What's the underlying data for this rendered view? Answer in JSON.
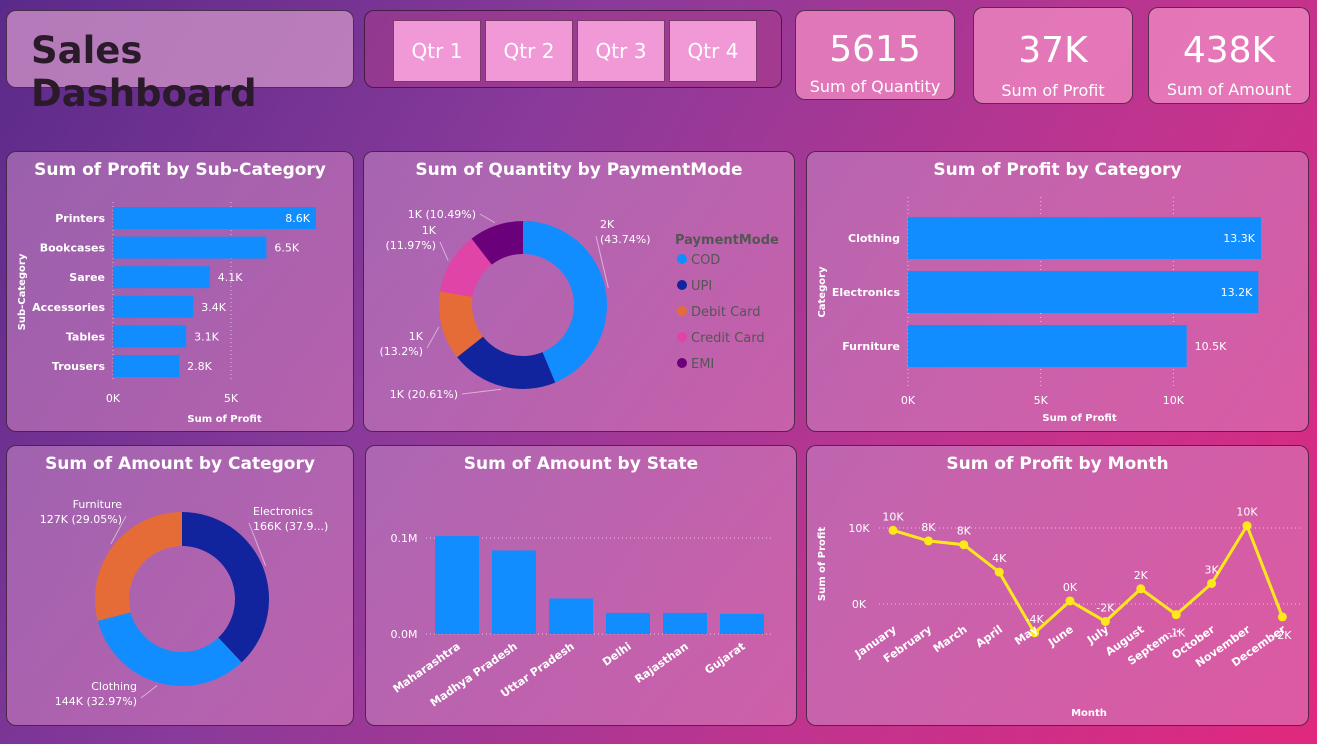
{
  "header": {
    "title": "Sales Dashboard",
    "quarters": [
      "Qtr 1",
      "Qtr 2",
      "Qtr 3",
      "Qtr 4"
    ]
  },
  "kpis": [
    {
      "value": "5615",
      "label": "Sum of Quantity"
    },
    {
      "value": "37K",
      "label": "Sum of Profit"
    },
    {
      "value": "438K",
      "label": "Sum of Amount"
    }
  ],
  "colors": {
    "bar": "#118dff",
    "line": "#ffe81a",
    "cod": "#118dff",
    "upi": "#12239e",
    "debit": "#e66c37",
    "credit": "#e044a7",
    "emi": "#6b007b",
    "electronics": "#12239e",
    "clothing": "#118dff",
    "furniture": "#e66c37"
  },
  "chart_data": [
    {
      "id": "profit_subcat",
      "type": "bar",
      "orientation": "horizontal",
      "title": "Sum of Profit by Sub-Category",
      "ylabel": "Sub-Category",
      "xlabel": "Sum of Profit",
      "categories": [
        "Printers",
        "Bookcases",
        "Saree",
        "Accessories",
        "Tables",
        "Trousers"
      ],
      "values": [
        8600,
        6500,
        4100,
        3400,
        3100,
        2800
      ],
      "labels": [
        "8.6K",
        "6.5K",
        "4.1K",
        "3.4K",
        "3.1K",
        "2.8K"
      ],
      "xticks": [
        {
          "v": 0,
          "t": "0K"
        },
        {
          "v": 5000,
          "t": "5K"
        }
      ],
      "xlim": [
        0,
        8600
      ]
    },
    {
      "id": "qty_payment",
      "type": "pie",
      "donut": true,
      "title": "Sum of Quantity by PaymentMode",
      "legend_title": "PaymentMode",
      "legend_position": "right",
      "categories": [
        "COD",
        "UPI",
        "Debit Card",
        "Credit Card",
        "EMI"
      ],
      "values": [
        43.74,
        20.61,
        13.2,
        11.97,
        10.49
      ],
      "labels": [
        [
          "2K",
          "(43.74%)"
        ],
        [
          "1K (20.61%)"
        ],
        [
          "1K",
          "(13.2%)"
        ],
        [
          "1K",
          "(11.97%)"
        ],
        [
          "1K (10.49%)"
        ]
      ]
    },
    {
      "id": "profit_category",
      "type": "bar",
      "orientation": "horizontal",
      "title": "Sum of Profit by Category",
      "ylabel": "Category",
      "xlabel": "Sum of Profit",
      "categories": [
        "Clothing",
        "Electronics",
        "Furniture"
      ],
      "values": [
        13300,
        13200,
        10500
      ],
      "labels": [
        "13.3K",
        "13.2K",
        "10.5K"
      ],
      "xticks": [
        {
          "v": 0,
          "t": "0K"
        },
        {
          "v": 5000,
          "t": "5K"
        },
        {
          "v": 10000,
          "t": "10K"
        }
      ],
      "xlim": [
        0,
        13300
      ]
    },
    {
      "id": "amount_category",
      "type": "pie",
      "donut": true,
      "title": "Sum of Amount by Category",
      "categories": [
        "Electronics",
        "Clothing",
        "Furniture"
      ],
      "values": [
        37.98,
        32.97,
        29.05
      ],
      "labels": [
        [
          "Electronics",
          "166K (37.9...)"
        ],
        [
          "Clothing",
          "144K (32.97%)"
        ],
        [
          "Furniture",
          "127K (29.05%)"
        ]
      ]
    },
    {
      "id": "amount_state",
      "type": "bar",
      "orientation": "vertical",
      "title": "Sum of Amount by State",
      "categories": [
        "Maharashtra",
        "Madhya Pradesh",
        "Uttar Pradesh",
        "Delhi",
        "Rajasthan",
        "Gujarat"
      ],
      "values": [
        0.102,
        0.087,
        0.037,
        0.022,
        0.022,
        0.021
      ],
      "yticks": [
        {
          "v": 0,
          "t": "0.0M"
        },
        {
          "v": 0.1,
          "t": "0.1M"
        }
      ],
      "ylim": [
        0,
        0.1
      ]
    },
    {
      "id": "profit_month",
      "type": "line",
      "title": "Sum of Profit by Month",
      "xlabel": "Month",
      "ylabel": "Sum of Profit",
      "categories": [
        "January",
        "February",
        "March",
        "April",
        "May",
        "June",
        "July",
        "August",
        "Septem...",
        "October",
        "November",
        "December"
      ],
      "values": [
        9700,
        8300,
        7800,
        4200,
        -3800,
        400,
        -2300,
        2000,
        -1400,
        2700,
        10300,
        -1700
      ],
      "labels": [
        "10K",
        "8K",
        "8K",
        "4K",
        "-4K",
        "0K",
        "-2K",
        "2K",
        "-1K",
        "3K",
        "10K",
        "-2K"
      ],
      "yticks": [
        {
          "v": 0,
          "t": "0K"
        },
        {
          "v": 10000,
          "t": "10K"
        }
      ],
      "ylim": [
        -4000,
        10300
      ]
    }
  ]
}
